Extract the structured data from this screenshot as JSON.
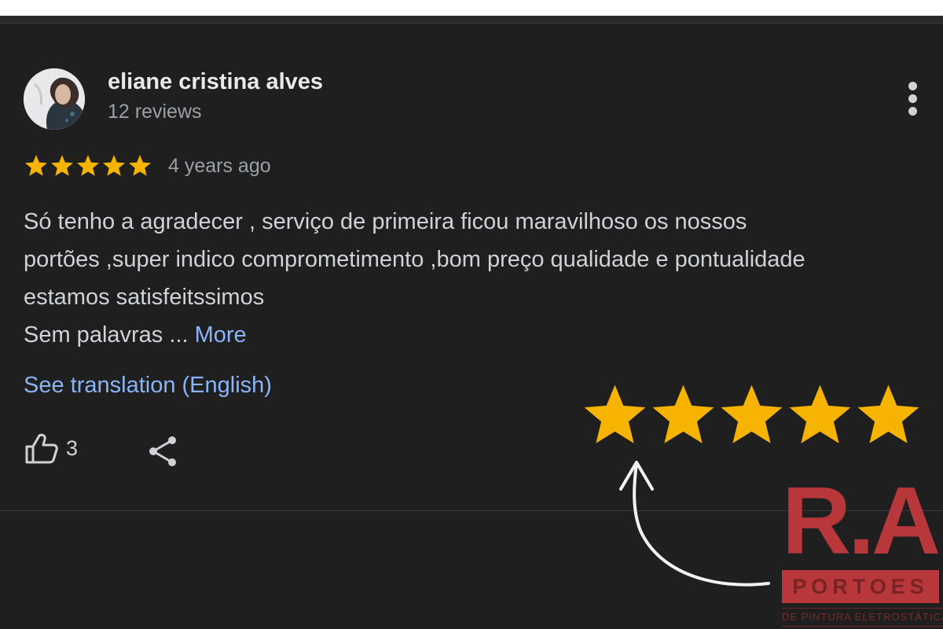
{
  "review": {
    "reviewer_name": "eliane cristina alves",
    "review_count": "12 reviews",
    "rating": 5,
    "rating_max": 5,
    "date": "4 years ago",
    "text_lines": [
      "Só tenho a agradecer , serviço de primeira ficou maravilhoso os nossos",
      "portões ,super indico comprometimento ,bom preço qualidade e pontualidade",
      "estamos satisfeitssimos",
      "Sem palavras ... "
    ],
    "more_label": "More",
    "see_translation": "See translation (English)",
    "likes": "3"
  },
  "overlay": {
    "big_star_count": 5,
    "star_color": "#f6b400",
    "logo_letters": "R.A",
    "logo_bar": "PORTOES",
    "logo_tagline": "DE PINTURA ELETROSTÁTICA"
  },
  "icons": [
    "avatar",
    "more-vert-icon",
    "star-icon",
    "thumb-up-icon",
    "share-icon",
    "curved-arrow"
  ],
  "colors": {
    "background": "#1f1f1f",
    "link": "#8ab4f8",
    "star": "#f6b400",
    "logo_red": "#b7373a"
  }
}
